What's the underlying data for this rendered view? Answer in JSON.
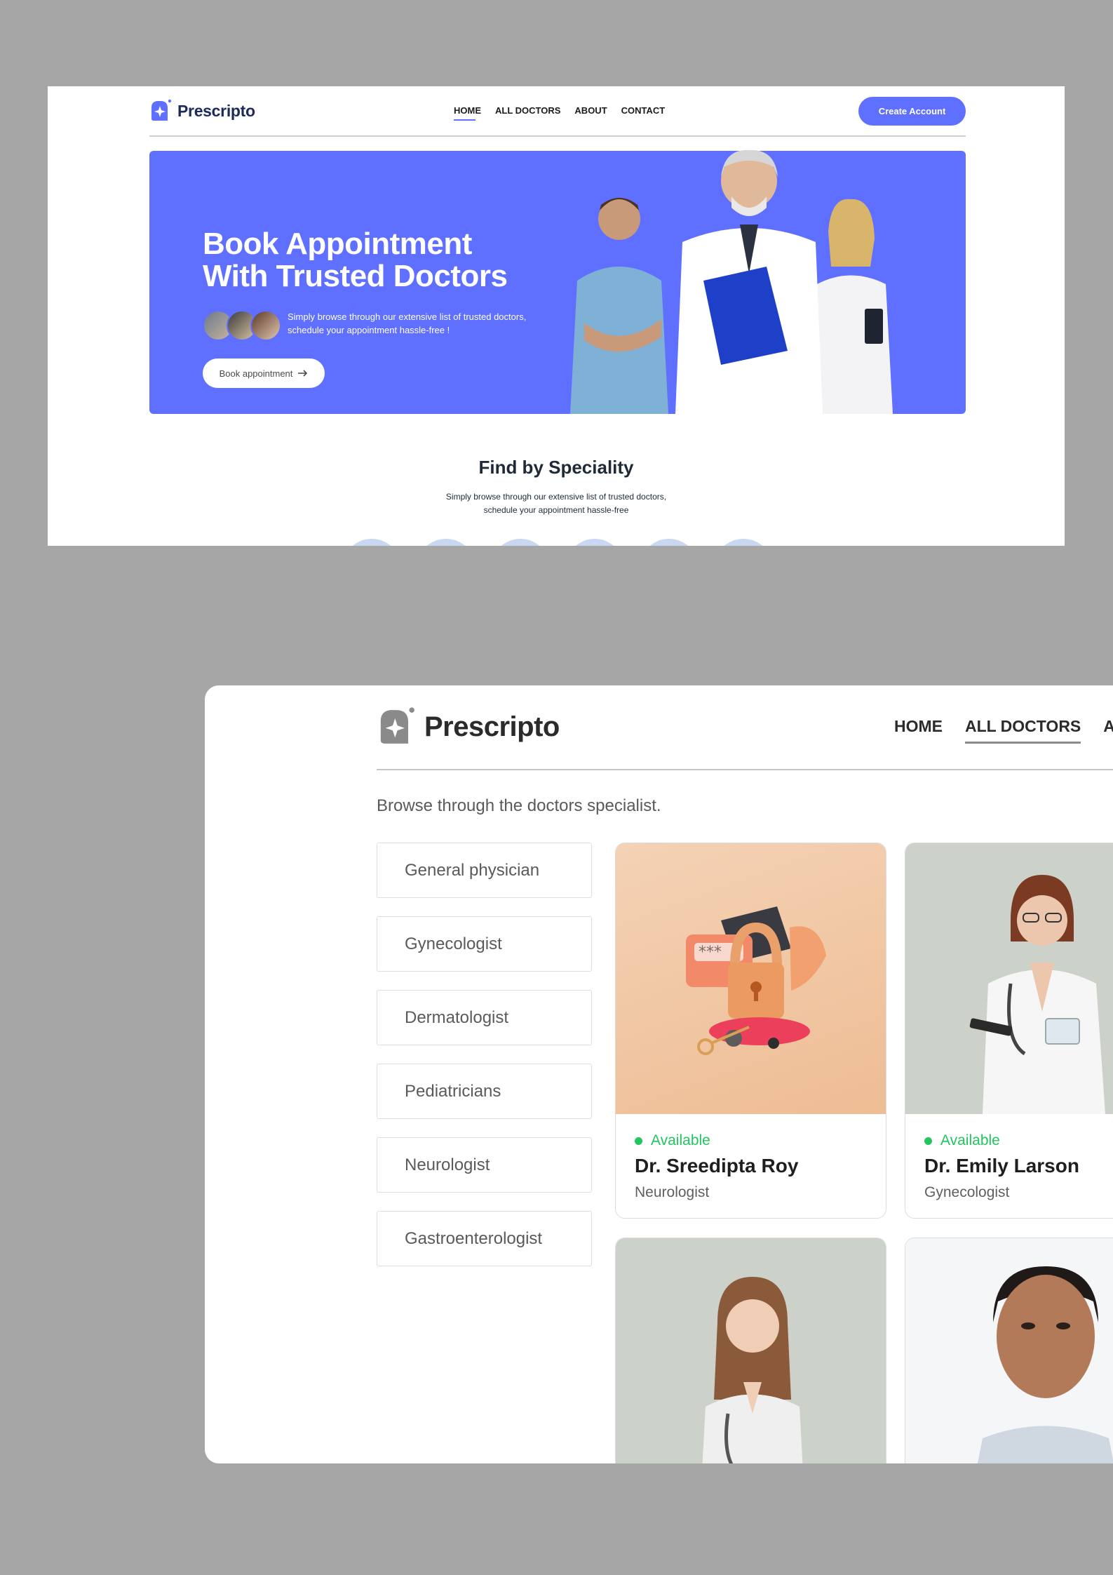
{
  "top": {
    "brand": "Prescripto",
    "nav": [
      "HOME",
      "ALL DOCTORS",
      "ABOUT",
      "CONTACT"
    ],
    "cta": "Create Account",
    "hero": {
      "title_line1": "Book Appointment",
      "title_line2": "With Trusted Doctors",
      "subtitle_line1": "Simply browse through our extensive list of trusted doctors,",
      "subtitle_line2": "schedule your appointment hassle-free !",
      "button": "Book appointment",
      "button_icon": "arrow-right-icon"
    },
    "speciality": {
      "title": "Find by Speciality",
      "subtitle_line1": "Simply browse through our extensive list of trusted doctors,",
      "subtitle_line2": "schedule your appointment hassle-free"
    }
  },
  "bottom": {
    "brand": "Prescripto",
    "nav": [
      "HOME",
      "ALL DOCTORS",
      "ABOUT"
    ],
    "browse": "Browse through the doctors specialist.",
    "filters": [
      "General physician",
      "Gynecologist",
      "Dermatologist",
      "Pediatricians",
      "Neurologist",
      "Gastroenterologist"
    ],
    "doctors": [
      {
        "status": "Available",
        "name": "Dr. Sreedipta Roy",
        "speciality": "Neurologist"
      },
      {
        "status": "Available",
        "name": "Dr. Emily Larson",
        "speciality": "Gynecologist"
      }
    ]
  },
  "colors": {
    "primary": "#5f6fff",
    "available": "#22c55e",
    "backdrop": "#a6a6a6"
  }
}
